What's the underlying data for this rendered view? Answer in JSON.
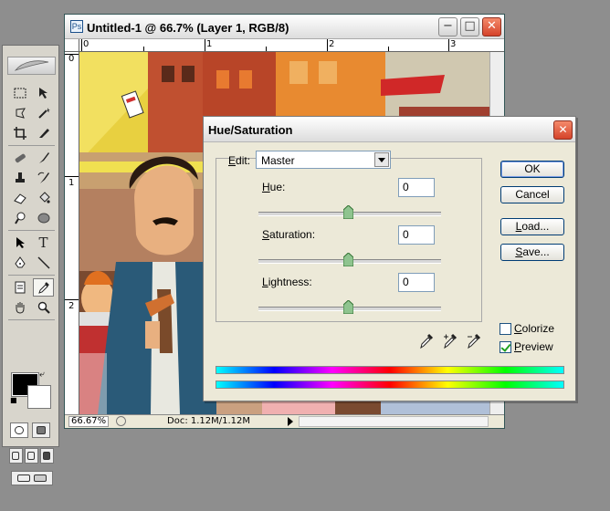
{
  "document": {
    "title": "Untitled-1 @ 66.7% (Layer 1, RGB/8)",
    "ruler_top": [
      "0",
      "1",
      "2",
      "3"
    ],
    "ruler_left": [
      "0",
      "1",
      "2"
    ],
    "zoom": "66.67%",
    "doc_info": "Doc: 1.12M/1.12M"
  },
  "dialog": {
    "title": "Hue/Saturation",
    "edit_label_prefix": "E",
    "edit_label_rest": "dit:",
    "edit_value": "Master",
    "hue": {
      "prefix": "H",
      "rest": "ue:",
      "value": "0"
    },
    "saturation": {
      "prefix": "S",
      "rest": "aturation:",
      "value": "0"
    },
    "lightness": {
      "prefix": "L",
      "rest": "ightness:",
      "value": "0"
    },
    "ok_label": "OK",
    "cancel_label": "Cancel",
    "load_prefix": "L",
    "load_rest": "oad...",
    "save_prefix": "S",
    "save_rest": "ave...",
    "colorize": {
      "prefix": "C",
      "rest": "olorize",
      "checked": false
    },
    "preview": {
      "prefix": "P",
      "rest": "review",
      "checked": true
    }
  },
  "toolbox": {
    "foreground_color": "#000000",
    "background_color": "#ffffff",
    "tools": [
      "marquee-icon",
      "move-icon",
      "lasso-icon",
      "magic-wand-icon",
      "crop-icon",
      "slice-icon",
      "healing-brush-icon",
      "brush-icon",
      "clone-stamp-icon",
      "history-brush-icon",
      "eraser-icon",
      "paint-bucket-icon",
      "dodge-icon",
      "blur-icon",
      "path-selection-icon",
      "type-icon",
      "pen-icon",
      "line-icon",
      "notes-icon",
      "eyedropper-icon",
      "hand-icon",
      "zoom-icon"
    ]
  }
}
